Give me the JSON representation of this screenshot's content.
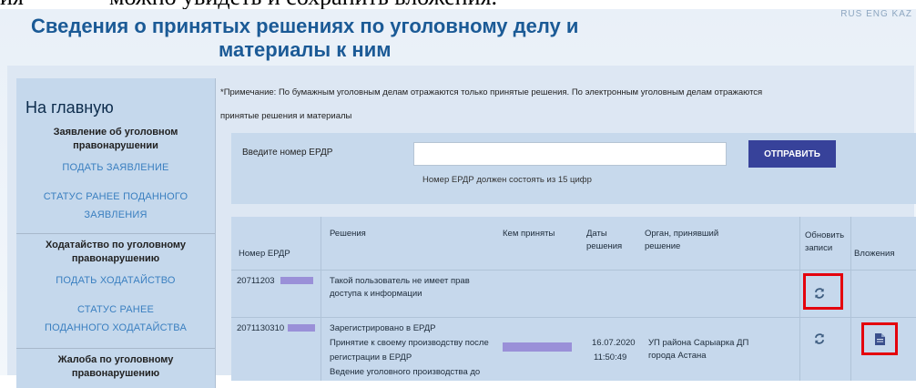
{
  "doc_top": {
    "left_text": "ия",
    "right_text": "можно увидеть и сохранить вложения."
  },
  "lang_links": "RUS   ENG   KAZ",
  "page": {
    "title_line1": "Сведения о принятых решениях по уголовному делу и",
    "title_line2": "материалы к ним",
    "note_line1": "*Примечание: По бумажным уголовным делам отражаются только принятые решения. По электронным уголовным делам отражаются",
    "note_line2": "принятые решения и материалы"
  },
  "sidebar": {
    "home": "На главную",
    "sections": [
      {
        "title": "Заявление об уголовном правонарушении",
        "links": [
          "ПОДАТЬ ЗАЯВЛЕНИЕ",
          "СТАТУС РАНЕЕ ПОДАННОГО ЗАЯВЛЕНИЯ"
        ]
      },
      {
        "title": "Ходатайство по уголовному правонарушению",
        "links": [
          "ПОДАТЬ ХОДАТАЙСТВО",
          "СТАТУС РАНЕЕ ПОДАННОГО ХОДАТАЙСТВА"
        ]
      },
      {
        "title": "Жалоба по уголовному правонарушению",
        "links": []
      }
    ]
  },
  "form": {
    "label": "Введите номер ЕРДР",
    "input_value": "",
    "hint": "Номер ЕРДР должен состоять из 15 цифр",
    "submit": "ОТПРАВИТЬ"
  },
  "table": {
    "headers": {
      "erdr": "Номер ЕРДР",
      "decisions": "Решения",
      "by_whom": "Кем приняты",
      "dates": "Даты решения",
      "organ": "Орган, принявший решение",
      "refresh": "Обновить записи",
      "attachments": "Вложения"
    },
    "rows": [
      {
        "erdr": "20711203",
        "decision": "Такой пользователь не имеет прав доступа к информации",
        "date": "",
        "time": "",
        "organ": ""
      },
      {
        "erdr": "2071130310",
        "decision_lines": [
          "Зарегистрировано в ЕРДР",
          "Принятие к своему производству после",
          "регистрации в ЕРДР",
          "Ведение уголовного производства до"
        ],
        "date": "16.07.2020",
        "time": "11:50:49",
        "organ": "УП района Сарыарка ДП города Астана"
      }
    ]
  },
  "icons": {
    "refresh": "refresh-icon",
    "document": "document-icon"
  },
  "colors": {
    "accent": "#37429a",
    "title": "#1b5a96",
    "highlight": "#e4000d",
    "redaction": "#9a90d8"
  }
}
